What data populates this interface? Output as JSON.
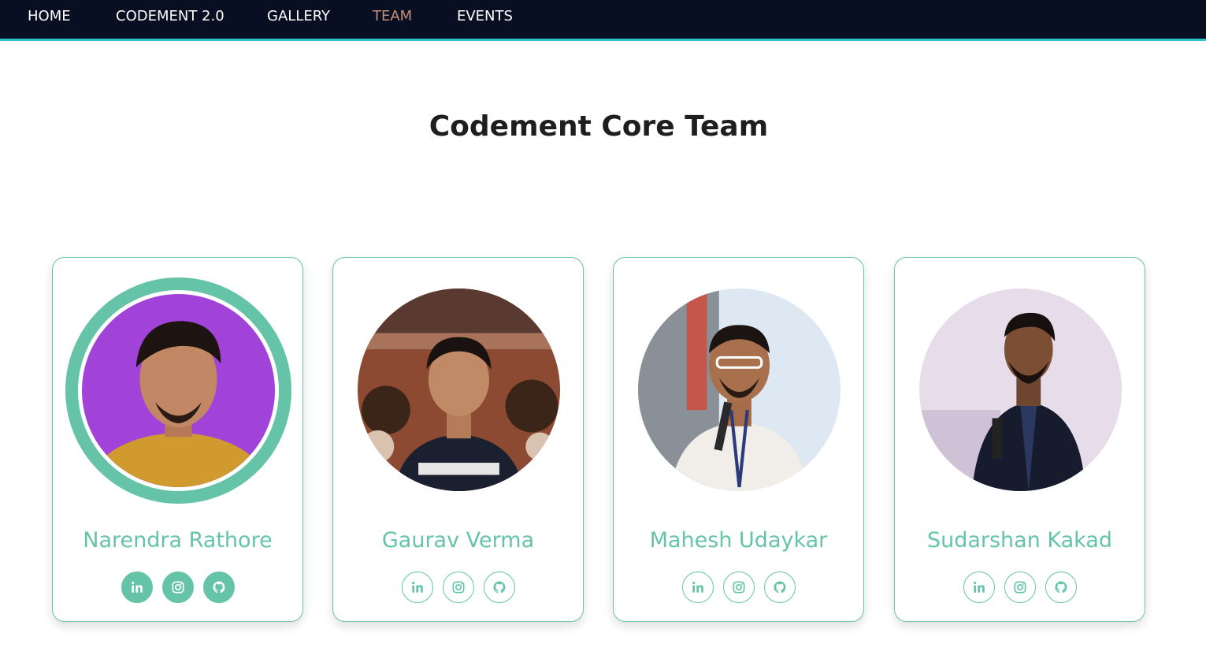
{
  "nav": {
    "items": [
      {
        "label": "HOME"
      },
      {
        "label": "CODEMENT 2.0"
      },
      {
        "label": "GALLERY"
      },
      {
        "label": "TEAM"
      },
      {
        "label": "EVENTS"
      }
    ],
    "active_item": "TEAM",
    "colors": {
      "background": "#080f22",
      "underline": "#2ec4c8",
      "active": "#c48e7a"
    }
  },
  "page": {
    "title": "Codement Core Team"
  },
  "theme": {
    "accent": "#65c4a8"
  },
  "members": [
    {
      "name": "Narendra Rathore",
      "highlighted": true,
      "socials": [
        "linkedin-icon",
        "instagram-icon",
        "github-icon"
      ]
    },
    {
      "name": "Gaurav Verma",
      "highlighted": false,
      "socials": [
        "linkedin-icon",
        "instagram-icon",
        "github-icon"
      ]
    },
    {
      "name": "Mahesh Udaykar",
      "highlighted": false,
      "socials": [
        "linkedin-icon",
        "instagram-icon",
        "github-icon"
      ]
    },
    {
      "name": "Sudarshan Kakad",
      "highlighted": false,
      "socials": [
        "linkedin-icon",
        "instagram-icon",
        "github-icon"
      ]
    }
  ]
}
